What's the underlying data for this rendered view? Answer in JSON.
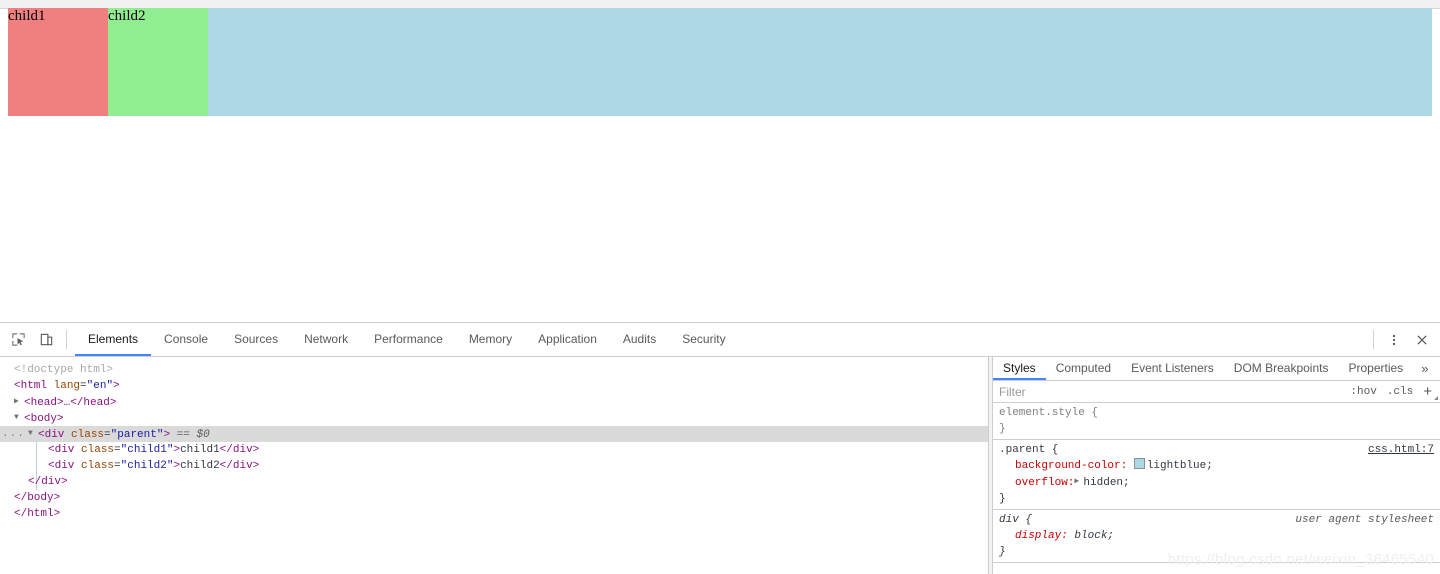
{
  "page": {
    "parent": {
      "label": "parent",
      "background_color": "#add8e6"
    },
    "children": [
      {
        "label": "child1",
        "background_color": "#f08080"
      },
      {
        "label": "child2",
        "background_color": "#90ee90"
      }
    ]
  },
  "devtools": {
    "toolbar": {
      "inspect_icon": "inspect-element-icon",
      "device_icon": "device-toolbar-icon",
      "menu_icon": "more-options-icon",
      "close_icon": "close-icon",
      "tabs": [
        {
          "label": "Elements",
          "active": true
        },
        {
          "label": "Console",
          "active": false
        },
        {
          "label": "Sources",
          "active": false
        },
        {
          "label": "Network",
          "active": false
        },
        {
          "label": "Performance",
          "active": false
        },
        {
          "label": "Memory",
          "active": false
        },
        {
          "label": "Application",
          "active": false
        },
        {
          "label": "Audits",
          "active": false
        },
        {
          "label": "Security",
          "active": false
        }
      ]
    },
    "dom": {
      "doctype": "<!doctype html>",
      "html_open_tag": "<html",
      "html_attr_name": "lang",
      "html_attr_value": "\"en\"",
      "html_open_close": ">",
      "head_collapsed": "<head>…</head>",
      "body_open": "<body>",
      "parent_open_tag": "<div",
      "parent_attr_name": "class",
      "parent_attr_value": "\"parent\"",
      "parent_open_close": ">",
      "selected_marker": "== $0",
      "ellipsis": "...",
      "child1_open": "<div",
      "child1_attr_name": "class",
      "child1_attr_value": "\"child1\"",
      "child1_open_close": ">",
      "child1_text": "child1",
      "child1_close": "</div>",
      "child2_open": "<div",
      "child2_attr_name": "class",
      "child2_attr_value": "\"child2\"",
      "child2_open_close": ">",
      "child2_text": "child2",
      "child2_close": "</div>",
      "parent_close": "</div>",
      "body_close": "</body>",
      "html_close": "</html>",
      "twisty_open": "▼",
      "twisty_closed": "▶"
    },
    "styles": {
      "tabs": [
        {
          "label": "Styles",
          "active": true
        },
        {
          "label": "Computed",
          "active": false
        },
        {
          "label": "Event Listeners",
          "active": false
        },
        {
          "label": "DOM Breakpoints",
          "active": false
        },
        {
          "label": "Properties",
          "active": false
        }
      ],
      "more_tabs_icon": "»",
      "filter_placeholder": "Filter",
      "filter_value": "",
      "hov_button": ":hov",
      "cls_button": ".cls",
      "new_rule_button": "+",
      "rules": [
        {
          "selector": "element.style {",
          "close": "}",
          "origin": "",
          "declarations": []
        },
        {
          "selector": ".parent {",
          "close": "}",
          "origin": "css.html:7",
          "declarations": [
            {
              "property": "background-color:",
              "value": "lightblue;",
              "swatch": "#add8e6"
            },
            {
              "property": "overflow:",
              "value": "hidden;",
              "twisty": "▶"
            }
          ]
        },
        {
          "selector": "div {",
          "close": "}",
          "origin": "user agent stylesheet",
          "declarations": [
            {
              "property": "display:",
              "value": "block;"
            }
          ]
        }
      ]
    }
  },
  "watermark": "https://blog.csdn.net/weixin_36465540"
}
